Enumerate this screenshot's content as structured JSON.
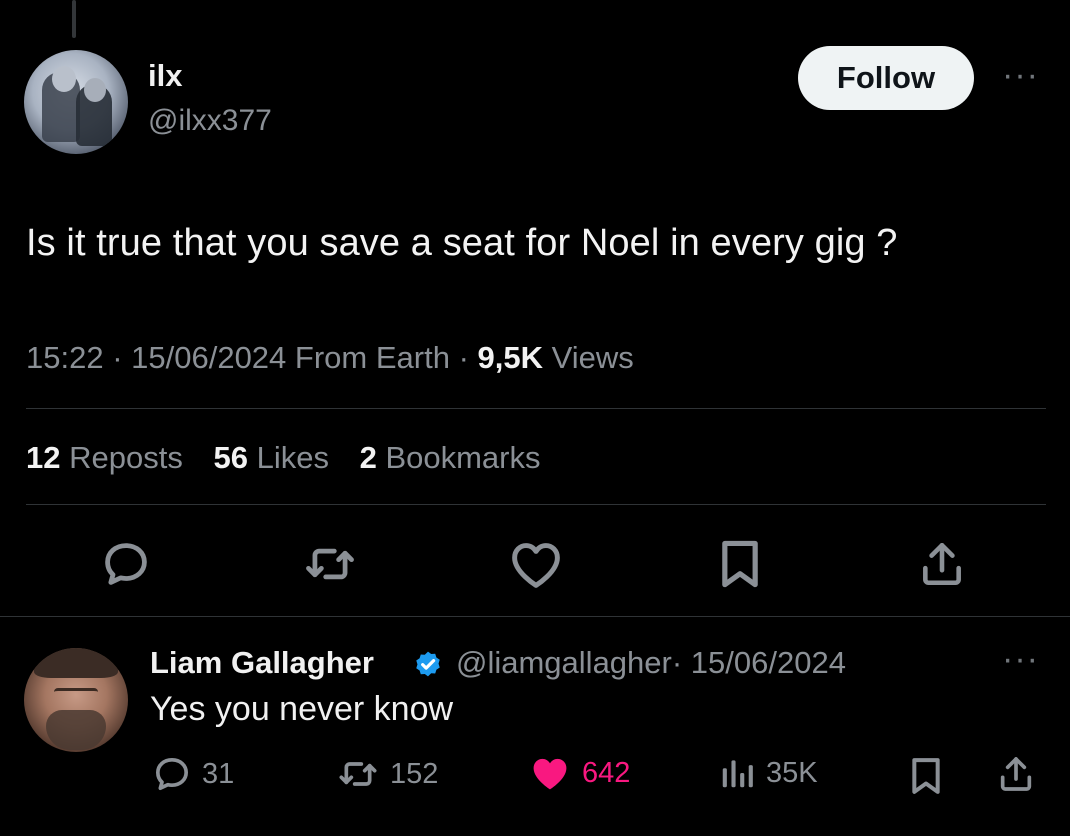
{
  "tweet": {
    "author": {
      "display_name": "ilx",
      "handle": "@ilxx377"
    },
    "follow_label": "Follow",
    "more_label": "···",
    "text": "Is it true that you save a seat for Noel in every gig ?",
    "meta": {
      "time": "15:22",
      "date": "15/06/2024",
      "source": "From Earth",
      "views_count": "9,5K",
      "views_label": "Views",
      "separator": " · "
    },
    "stats": {
      "reposts_count": "12",
      "reposts_label": "Reposts",
      "likes_count": "56",
      "likes_label": "Likes",
      "bookmarks_count": "2",
      "bookmarks_label": "Bookmarks"
    }
  },
  "reply": {
    "author": {
      "display_name": "Liam Gallagher",
      "handle": "@liamgallagher",
      "date": "· 15/06/2024",
      "verified": true
    },
    "more_label": "···",
    "text": "Yes you never know",
    "actions": {
      "replies": "31",
      "reposts": "152",
      "likes": "642",
      "views": "35K"
    }
  },
  "colors": {
    "background": "#000000",
    "primary_text": "#e7e9ea",
    "secondary_text": "#8b9096",
    "like_active": "#f91880",
    "verified_badge": "#1d9bf0",
    "divider": "#2f3336"
  }
}
